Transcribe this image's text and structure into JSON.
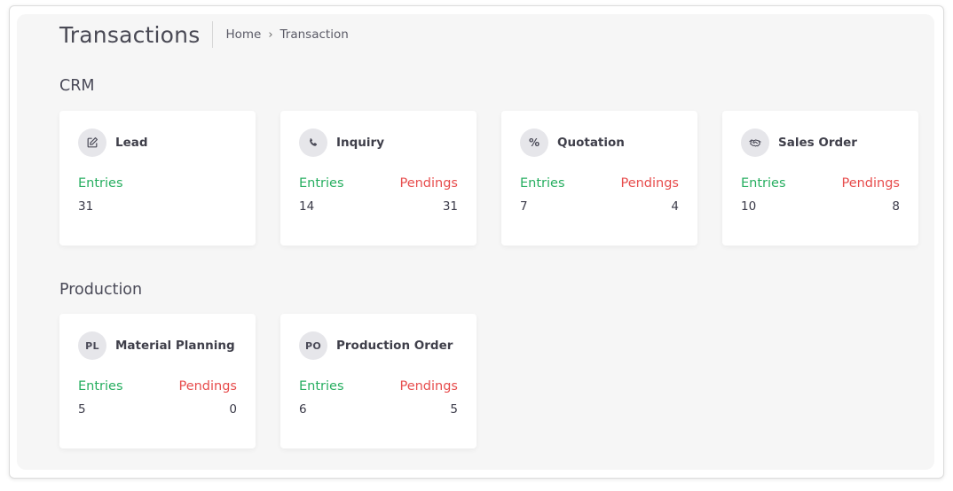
{
  "header": {
    "title": "Transactions",
    "breadcrumb": [
      "Home",
      "Transaction"
    ],
    "breadcrumb_separator": "›"
  },
  "sections": [
    {
      "title": "CRM",
      "cards": [
        {
          "title": "Lead",
          "icon": "edit-icon",
          "entries_label": "Entries",
          "entries": "31"
        },
        {
          "title": "Inquiry",
          "icon": "phone-icon",
          "entries_label": "Entries",
          "entries": "14",
          "pendings_label": "Pendings",
          "pendings": "31"
        },
        {
          "title": "Quotation",
          "icon": "percent-icon",
          "icon_text": "%",
          "entries_label": "Entries",
          "entries": "7",
          "pendings_label": "Pendings",
          "pendings": "4"
        },
        {
          "title": "Sales Order",
          "icon": "handshake-icon",
          "entries_label": "Entries",
          "entries": "10",
          "pendings_label": "Pendings",
          "pendings": "8"
        }
      ]
    },
    {
      "title": "Production",
      "cards": [
        {
          "title": "Material Planning",
          "icon": "pl-badge-icon",
          "icon_text": "PL",
          "entries_label": "Entries",
          "entries": "5",
          "pendings_label": "Pendings",
          "pendings": "0"
        },
        {
          "title": "Production Order",
          "icon": "po-badge-icon",
          "icon_text": "PO",
          "entries_label": "Entries",
          "entries": "6",
          "pendings_label": "Pendings",
          "pendings": "5"
        }
      ]
    }
  ],
  "colors": {
    "entries": "#27ae60",
    "pendings": "#e74c4c",
    "icon_bg": "#e6e6ea",
    "panel_bg": "#f6f6f6"
  }
}
